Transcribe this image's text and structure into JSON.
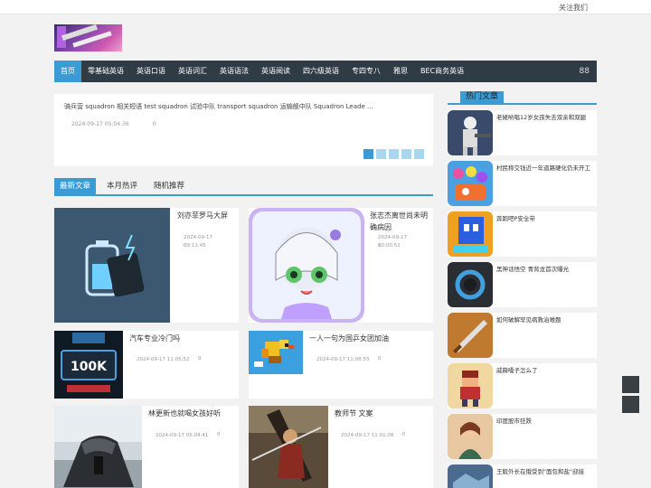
{
  "topbar": {
    "follow": "关注我们"
  },
  "nav": {
    "items": [
      "首页",
      "零基础英语",
      "英语口语",
      "英语词汇",
      "英语语法",
      "英语阅读",
      "四六级英语",
      "专四专八",
      "雅思",
      "BEC商务英语"
    ],
    "grid_icon": "88"
  },
  "featured": {
    "line": "骑兵营   squadron 相关短语   test squadron 试验中队  transport squadron 运输舰中队 Squadron Leade ...",
    "date": "2024-09-17 05:04:36",
    "count": "0"
  },
  "tabs": [
    "最新文章",
    "本月热评",
    "随机推荐"
  ],
  "articles": [
    {
      "title": "刘亦菲罗马大屏",
      "date": "2024-09-17 09:11:45",
      "count": "0"
    },
    {
      "title": "张志杰离世尚未明确病因",
      "date": "2024-09-17 10:00:51",
      "count": "0"
    },
    {
      "title": "汽车专业冷门吗",
      "date": "2024-09-17 11:05:52",
      "count": "0"
    },
    {
      "title": "一人一句为国乒女团加油",
      "date": "2024-09-17 11:08:53",
      "count": "0"
    },
    {
      "title": "林更新也就喝女孩好听",
      "date": "2024-09-17 05:04:41",
      "count": "0"
    },
    {
      "title": "教师节 文案",
      "date": "2024-09-17 11:01:08",
      "count": "0"
    }
  ],
  "sidebar": {
    "heading": "热门文章",
    "items": [
      {
        "title": "老姥哟唱12岁女孩失去双亲和双腿",
        "icon": "robot-soldier-icon"
      },
      {
        "title": "村民称交钱近一年道路硬化仍未开工",
        "icon": "candy-game-icon"
      },
      {
        "title": "奔跑吧P安全带",
        "icon": "cube-runner-icon"
      },
      {
        "title": "黑神话悟空 青背龙首次曝光",
        "icon": "ring-icon"
      },
      {
        "title": "如何破解罕见病救治难题",
        "icon": "sword-icon"
      },
      {
        "title": "戚薇嗓子怎么了",
        "icon": "pixel-hero-icon"
      },
      {
        "title": "印度股市狂跌",
        "icon": "lady-portrait-icon"
      },
      {
        "title": "王毅外长在俄受到\"面包和盐\"迎接",
        "icon": "map-icon"
      }
    ]
  },
  "colors": {
    "accent": "#3a9bd5",
    "nav_bg": "#2f3b45",
    "page_bg": "#f2f2f2"
  }
}
